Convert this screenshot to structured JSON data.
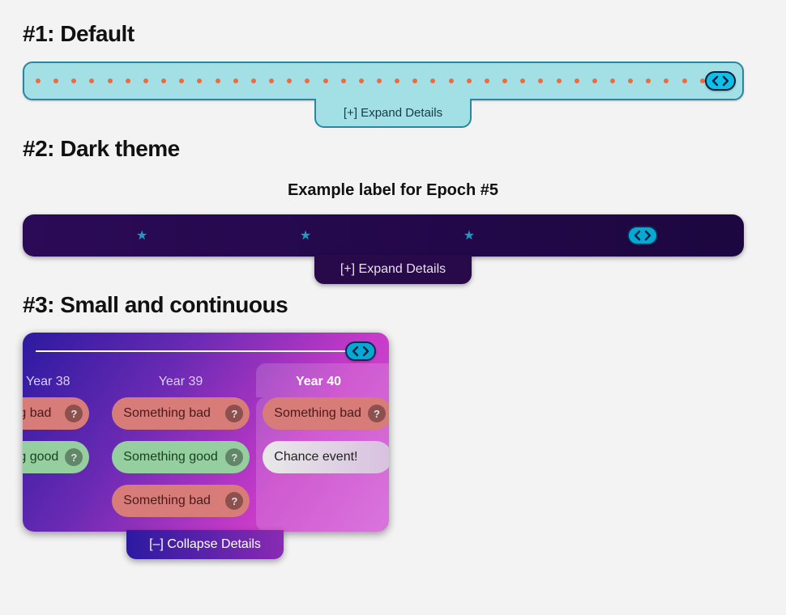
{
  "section1": {
    "heading": "#1: Default",
    "tick_count": 39,
    "tick_color": "#f06a3b",
    "expand_label": "[+] Expand Details"
  },
  "section2": {
    "heading": "#2: Dark theme",
    "epoch_label": "Example label for Epoch #5",
    "tick_count": 4,
    "tick_glyph": "★",
    "expand_label": "[+] Expand Details"
  },
  "section3": {
    "heading": "#3: Small and continuous",
    "years": [
      "Year 38",
      "Year 39",
      "Year 40"
    ],
    "columns": [
      [
        {
          "label": "hing bad",
          "kind": "bad",
          "help": "?"
        },
        {
          "label": "hing good",
          "kind": "good",
          "help": "?"
        }
      ],
      [
        {
          "label": "Something bad",
          "kind": "bad",
          "help": "?"
        },
        {
          "label": "Something good",
          "kind": "good",
          "help": "?"
        },
        {
          "label": "Something bad",
          "kind": "bad",
          "help": "?"
        }
      ],
      [
        {
          "label": "Something bad",
          "kind": "bad",
          "help": "?"
        },
        {
          "label": "Chance event!",
          "kind": "chance"
        }
      ]
    ],
    "collapse_label": "[–] Collapse Details"
  }
}
